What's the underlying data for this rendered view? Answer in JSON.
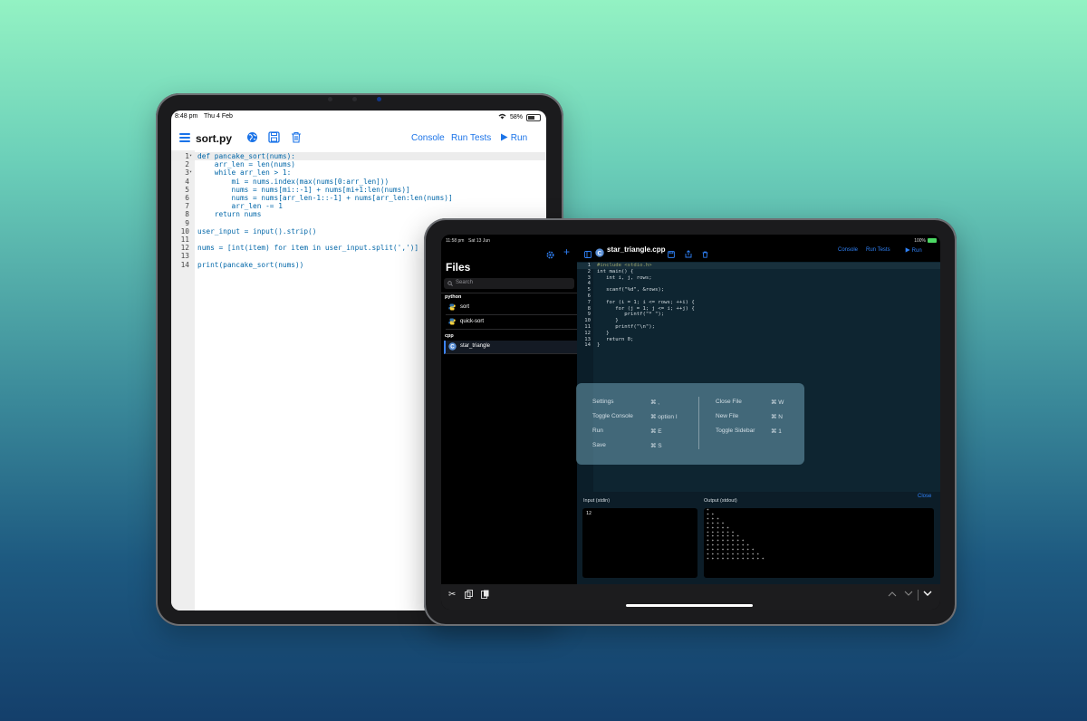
{
  "ipad1": {
    "status": {
      "time": "8:48 pm",
      "date": "Thu 4 Feb",
      "battery": "58%"
    },
    "toolbar": {
      "file_name": "sort.py",
      "console_label": "Console",
      "run_tests_label": "Run Tests",
      "run_label": "Run"
    },
    "code_lines": [
      {
        "n": "1",
        "fold": "▾",
        "text": "def pancake_sort(nums):"
      },
      {
        "n": "2",
        "fold": "",
        "text": "    arr_len = len(nums)"
      },
      {
        "n": "3",
        "fold": "▾",
        "text": "    while arr_len > 1:"
      },
      {
        "n": "4",
        "fold": "",
        "text": "        mi = nums.index(max(nums[0:arr_len]))"
      },
      {
        "n": "5",
        "fold": "",
        "text": "        nums = nums[mi::-1] + nums[mi+1:len(nums)]"
      },
      {
        "n": "6",
        "fold": "",
        "text": "        nums = nums[arr_len-1::-1] + nums[arr_len:len(nums)]"
      },
      {
        "n": "7",
        "fold": "",
        "text": "        arr_len -= 1"
      },
      {
        "n": "8",
        "fold": "",
        "text": "    return nums"
      },
      {
        "n": "9",
        "fold": "",
        "text": ""
      },
      {
        "n": "10",
        "fold": "",
        "text": "user_input = input().strip()"
      },
      {
        "n": "11",
        "fold": "",
        "text": ""
      },
      {
        "n": "12",
        "fold": "",
        "text": "nums = [int(item) for item in user_input.split(',')]"
      },
      {
        "n": "13",
        "fold": "",
        "text": ""
      },
      {
        "n": "14",
        "fold": "",
        "text": "print(pancake_sort(nums))"
      }
    ]
  },
  "ipad2": {
    "status": {
      "time": "11:58 pm",
      "date": "Sat 13 Jun",
      "battery": "100%"
    },
    "sidebar": {
      "title": "Files",
      "search_placeholder": "Search",
      "groups": [
        {
          "name": "python",
          "items": [
            {
              "label": "sort",
              "icon": "python-icon"
            },
            {
              "label": "quick-sort",
              "icon": "python-icon"
            }
          ]
        },
        {
          "name": "cpp",
          "items": [
            {
              "label": "star_triangle",
              "icon": "cpp-icon",
              "selected": true
            }
          ]
        }
      ]
    },
    "toolbar": {
      "file_name": "star_triangle.cpp",
      "console_label": "Console",
      "run_tests_label": "Run Tests",
      "run_label": "Run"
    },
    "code_lines": [
      {
        "n": "1",
        "text": "#include <stdio.h>"
      },
      {
        "n": "2",
        "text": "int main() {"
      },
      {
        "n": "3",
        "text": "   int i, j, rows;"
      },
      {
        "n": "4",
        "text": ""
      },
      {
        "n": "5",
        "text": "   scanf(\"%d\", &rows);"
      },
      {
        "n": "6",
        "text": ""
      },
      {
        "n": "7",
        "text": "   for (i = 1; i <= rows; ++i) {"
      },
      {
        "n": "8",
        "text": "      for (j = 1; j <= i; ++j) {"
      },
      {
        "n": "9",
        "text": "         printf(\"* \");"
      },
      {
        "n": "10",
        "text": "      }"
      },
      {
        "n": "11",
        "text": "      printf(\"\\n\");"
      },
      {
        "n": "12",
        "text": "   }"
      },
      {
        "n": "13",
        "text": "   return 0;"
      },
      {
        "n": "14",
        "text": "}"
      }
    ],
    "shortcuts": {
      "left": [
        {
          "label": "Settings",
          "keys": "⌘ ,"
        },
        {
          "label": "Toggle Console",
          "keys": "⌘ option I"
        },
        {
          "label": "Run",
          "keys": "⌘ E"
        },
        {
          "label": "Save",
          "keys": "⌘ S"
        }
      ],
      "right": [
        {
          "label": "Close File",
          "keys": "⌘ W"
        },
        {
          "label": "New File",
          "keys": "⌘ N"
        },
        {
          "label": "Toggle Sidebar",
          "keys": "⌘ 1"
        }
      ]
    },
    "console": {
      "input_label": "Input (stdin)",
      "output_label": "Output (stdout)",
      "close_label": "Close",
      "input_value": "12",
      "output_lines": [
        "*",
        "* *",
        "* * *",
        "* * * *",
        "* * * * *",
        "* * * * * *",
        "* * * * * * *",
        "* * * * * * * *",
        "* * * * * * * * *",
        "* * * * * * * * * *",
        "* * * * * * * * * * *",
        "* * * * * * * * * * * *"
      ]
    }
  },
  "colors": {
    "accent": "#1a73e8",
    "dark_editor_bg": "#0e2531",
    "page_gradient_top": "#93f2c3",
    "page_gradient_bottom": "#143f6b"
  }
}
